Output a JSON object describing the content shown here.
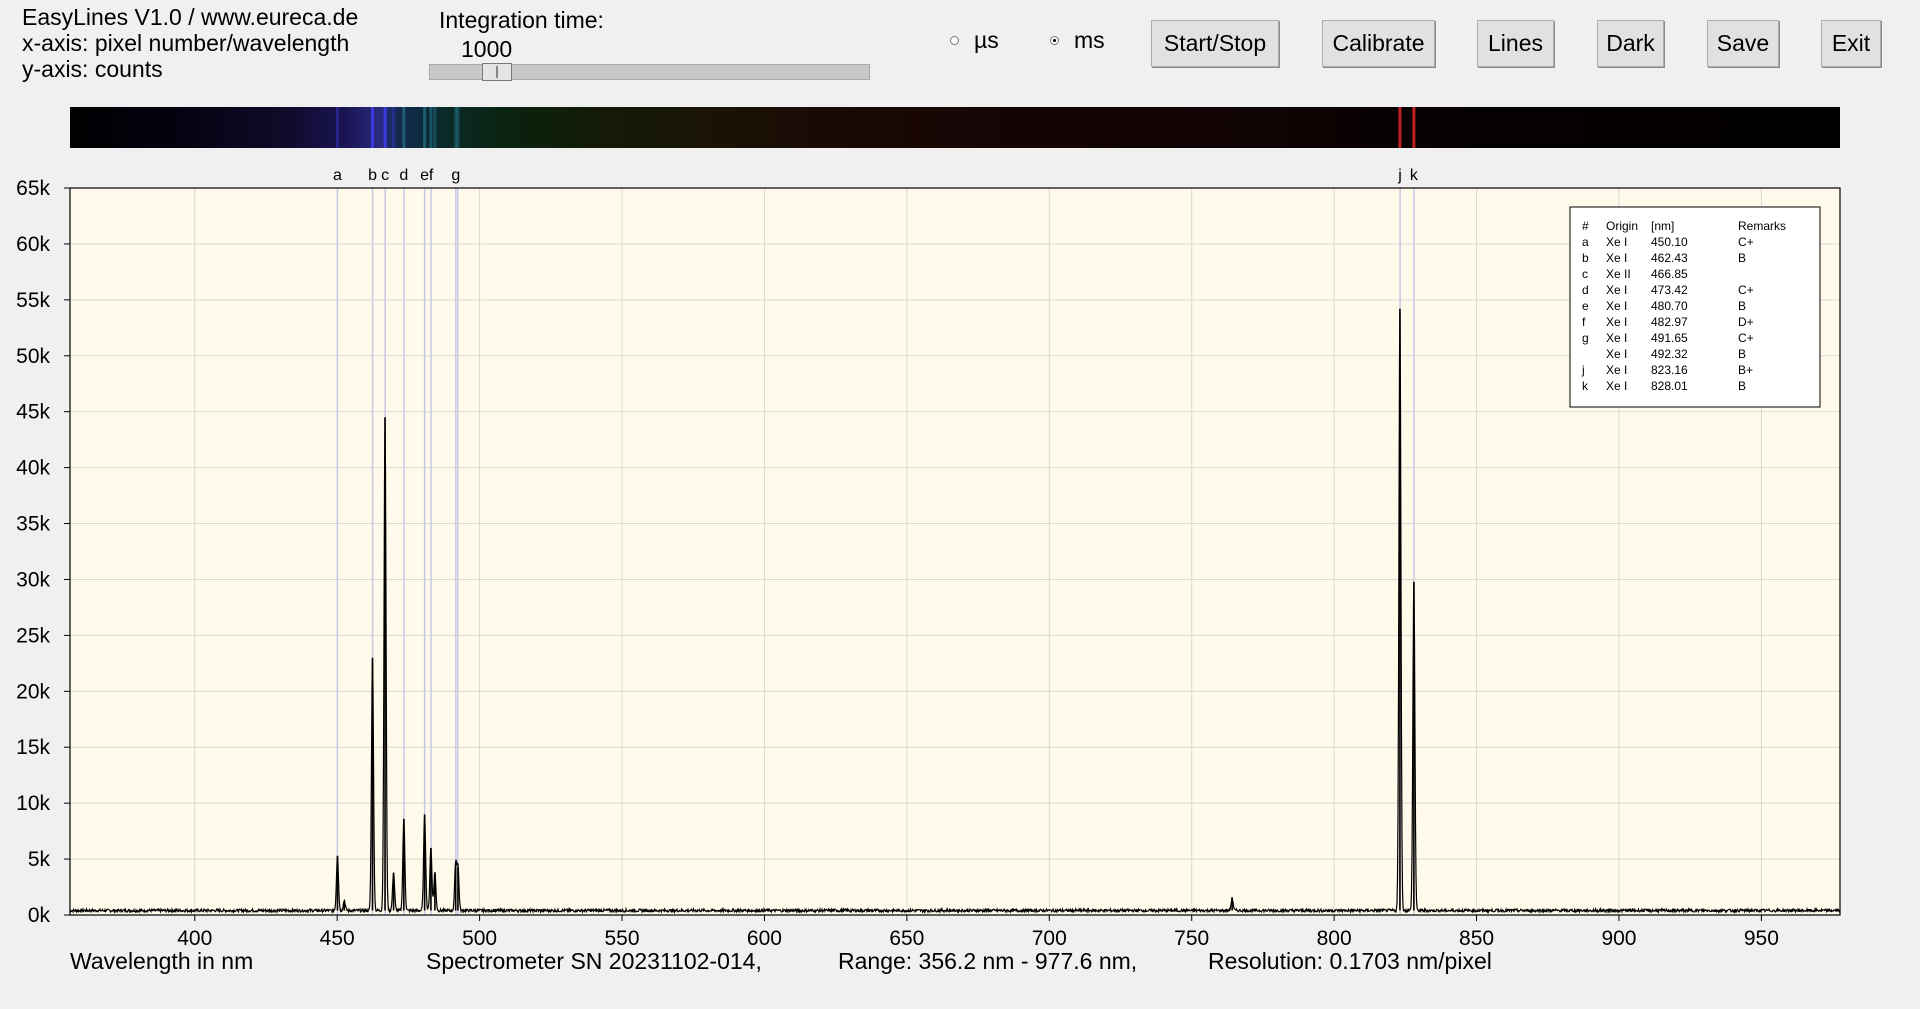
{
  "header": {
    "app_title": "EasyLines V1.0 / www.eureca.de",
    "x_axis_info": "x-axis: pixel number/wavelength",
    "y_axis_info": "y-axis: counts",
    "integration_time_label": "Integration time:",
    "integration_time_value": "1000",
    "slider_fraction": 0.09
  },
  "units": {
    "us_label": "µs",
    "ms_label": "ms",
    "selected": "ms"
  },
  "toolbar": {
    "start_stop": "Start/Stop",
    "calibrate": "Calibrate",
    "lines": "Lines",
    "dark": "Dark",
    "save": "Save",
    "exit": "Exit"
  },
  "colors": {
    "plot_background": "#fffaea",
    "marker_line": "#c8c8e8",
    "spectrum_line": "#000000",
    "grid": "#d8d8d8"
  },
  "chart_data": {
    "type": "line",
    "title": "",
    "xlabel": "Wavelength in nm",
    "ylabel": "",
    "xlim": [
      356.2,
      977.6
    ],
    "ylim": [
      0,
      65000
    ],
    "grid": true,
    "x_ticks": [
      400,
      450,
      500,
      550,
      600,
      650,
      700,
      750,
      800,
      850,
      900,
      950
    ],
    "y_ticks": [
      0,
      5000,
      10000,
      15000,
      20000,
      25000,
      30000,
      35000,
      40000,
      45000,
      50000,
      55000,
      60000,
      65000
    ],
    "y_tick_labels": [
      "0k",
      "5k",
      "10k",
      "15k",
      "20k",
      "25k",
      "30k",
      "35k",
      "40k",
      "45k",
      "50k",
      "55k",
      "60k",
      "65k"
    ],
    "baseline": 400,
    "peaks": [
      {
        "x": 450.1,
        "y": 5300
      },
      {
        "x": 452.5,
        "y": 1300
      },
      {
        "x": 462.4,
        "y": 23000
      },
      {
        "x": 466.8,
        "y": 44500
      },
      {
        "x": 469.8,
        "y": 3800
      },
      {
        "x": 473.4,
        "y": 8600
      },
      {
        "x": 480.7,
        "y": 9000
      },
      {
        "x": 482.9,
        "y": 6000
      },
      {
        "x": 484.3,
        "y": 3800
      },
      {
        "x": 491.6,
        "y": 4600
      },
      {
        "x": 492.4,
        "y": 4300
      },
      {
        "x": 764.2,
        "y": 1500
      },
      {
        "x": 823.1,
        "y": 54200
      },
      {
        "x": 828.0,
        "y": 29800
      }
    ],
    "marker_lines": [
      {
        "letter": "a",
        "x": 450.1
      },
      {
        "letter": "b",
        "x": 462.43
      },
      {
        "letter": "c",
        "x": 466.85
      },
      {
        "letter": "d",
        "x": 473.42
      },
      {
        "letter": "e",
        "x": 480.7
      },
      {
        "letter": "f",
        "x": 482.97
      },
      {
        "letter": "g",
        "x": 491.65
      },
      {
        "letter": "",
        "x": 492.32
      },
      {
        "letter": "j",
        "x": 823.16
      },
      {
        "letter": "k",
        "x": 828.01
      }
    ],
    "legend": {
      "placement": "top-right",
      "headers": [
        "#",
        "Origin",
        "[nm]",
        "Remarks"
      ],
      "rows": [
        [
          "a",
          "Xe I",
          "450.10",
          "C+"
        ],
        [
          "b",
          "Xe I",
          "462.43",
          "B"
        ],
        [
          "c",
          "Xe II",
          "466.85",
          ""
        ],
        [
          "d",
          "Xe I",
          "473.42",
          "C+"
        ],
        [
          "e",
          "Xe I",
          "480.70",
          "B"
        ],
        [
          "f",
          "Xe I",
          "482.97",
          "D+"
        ],
        [
          "g",
          "Xe I",
          "491.65",
          "C+"
        ],
        [
          "",
          "Xe I",
          "492.32",
          "B"
        ],
        [
          "j",
          "Xe I",
          "823.16",
          "B+"
        ],
        [
          "k",
          "Xe I",
          "828.01",
          "B"
        ]
      ]
    }
  },
  "footer": {
    "xlabel": "Wavelength in nm",
    "spectrometer": "Spectrometer SN 20231102-014,",
    "range": "Range: 356.2 nm - 977.6 nm,",
    "resolution": "Resolution: 0.1703 nm/pixel"
  }
}
